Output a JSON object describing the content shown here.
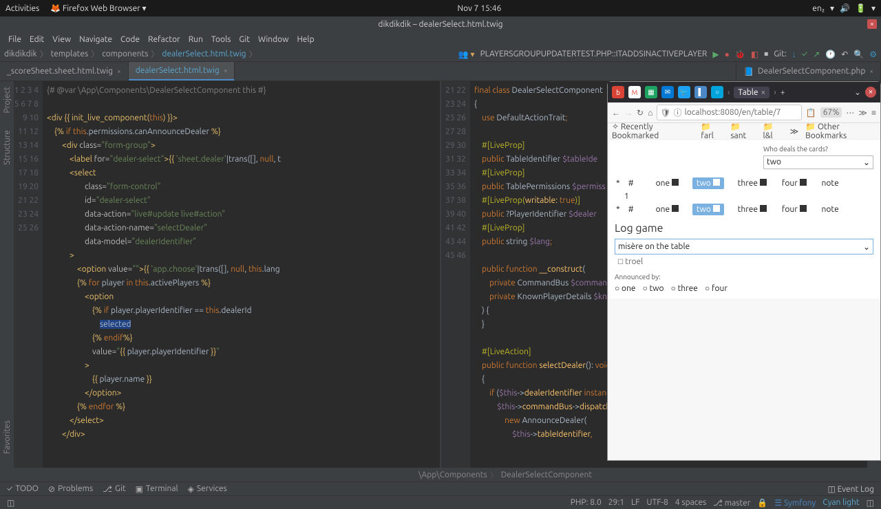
{
  "topbar": {
    "activities": "Activities",
    "browser": "Firefox Web Browser",
    "time": "Nov 7 15:46",
    "lang": "en₂"
  },
  "title": "dikdikdik – dealerSelect.html.twig",
  "menu": [
    "File",
    "Edit",
    "View",
    "Navigate",
    "Code",
    "Refactor",
    "Run",
    "Tools",
    "Git",
    "Window",
    "Help"
  ],
  "breadcrumb": {
    "project": "dikdikdik",
    "p1": "templates",
    "p2": "components",
    "file": "dealerSelect.html.twig"
  },
  "toolbar": {
    "config": "PLAYERSGROUPUPDATERTEST.PHP::ITADDSINACTIVEPLAYER",
    "git": "Git:"
  },
  "tabs": {
    "left": [
      {
        "label": "_scoreSheet.sheet.html.twig",
        "active": false
      },
      {
        "label": "dealerSelect.html.twig",
        "active": true
      }
    ],
    "right": [
      {
        "label": "DealerSelectComponent.php",
        "active": false
      }
    ]
  },
  "sidebar": {
    "project": "Project",
    "structure": "Structure",
    "favorites": "Favorites"
  },
  "editor1": {
    "lines": [
      "1",
      "2",
      "3",
      "4",
      "5",
      "6",
      "7",
      "8",
      "9",
      "10",
      "11",
      "12",
      "13",
      "14",
      "15",
      "16",
      "17",
      "18",
      "19",
      "20",
      "21",
      "22",
      "23",
      "24",
      "25",
      "26"
    ]
  },
  "editor2": {
    "lines": [
      "21",
      "22",
      "23",
      "24",
      "25",
      "26",
      "27",
      "28",
      "29",
      "30",
      "31",
      "32",
      "33",
      "34",
      "35",
      "36",
      "37",
      "38",
      "39",
      "40",
      "41",
      "42",
      "43",
      "44",
      "45",
      "46"
    ]
  },
  "browser": {
    "tab": "Table",
    "url": "localhost:8080/en/table/7",
    "zoom": "67%",
    "bookmarks": {
      "rec": "Recently Bookmarked",
      "f1": "farl",
      "f2": "sant",
      "f3": "l&l",
      "other": "Other Bookmarks"
    },
    "who": "Who deals the cards?",
    "dealer": "two",
    "headers": {
      "star": "*",
      "hash": "#",
      "one": "one",
      "two": "two",
      "three": "three",
      "four": "four",
      "note": "note",
      "row1": "1"
    },
    "loggame": "Log game",
    "gametype": "misère on the table",
    "dropdown_opt": "troel",
    "announced": "Announced by:",
    "players": [
      "one",
      "two",
      "three",
      "four"
    ]
  },
  "bottomCrumb": {
    "p1": "\\App\\Components",
    "p2": "DealerSelectComponent"
  },
  "bottomTools": {
    "todo": "TODO",
    "problems": "Problems",
    "git": "Git",
    "terminal": "Terminal",
    "services": "Services",
    "event": "Event Log"
  },
  "status": {
    "php": "PHP: 8.0",
    "pos": "29:1",
    "lf": "LF",
    "enc": "UTF-8",
    "sp": "4 spaces",
    "branch": "master",
    "sym": "Symfony",
    "lang": "Cyan light"
  }
}
